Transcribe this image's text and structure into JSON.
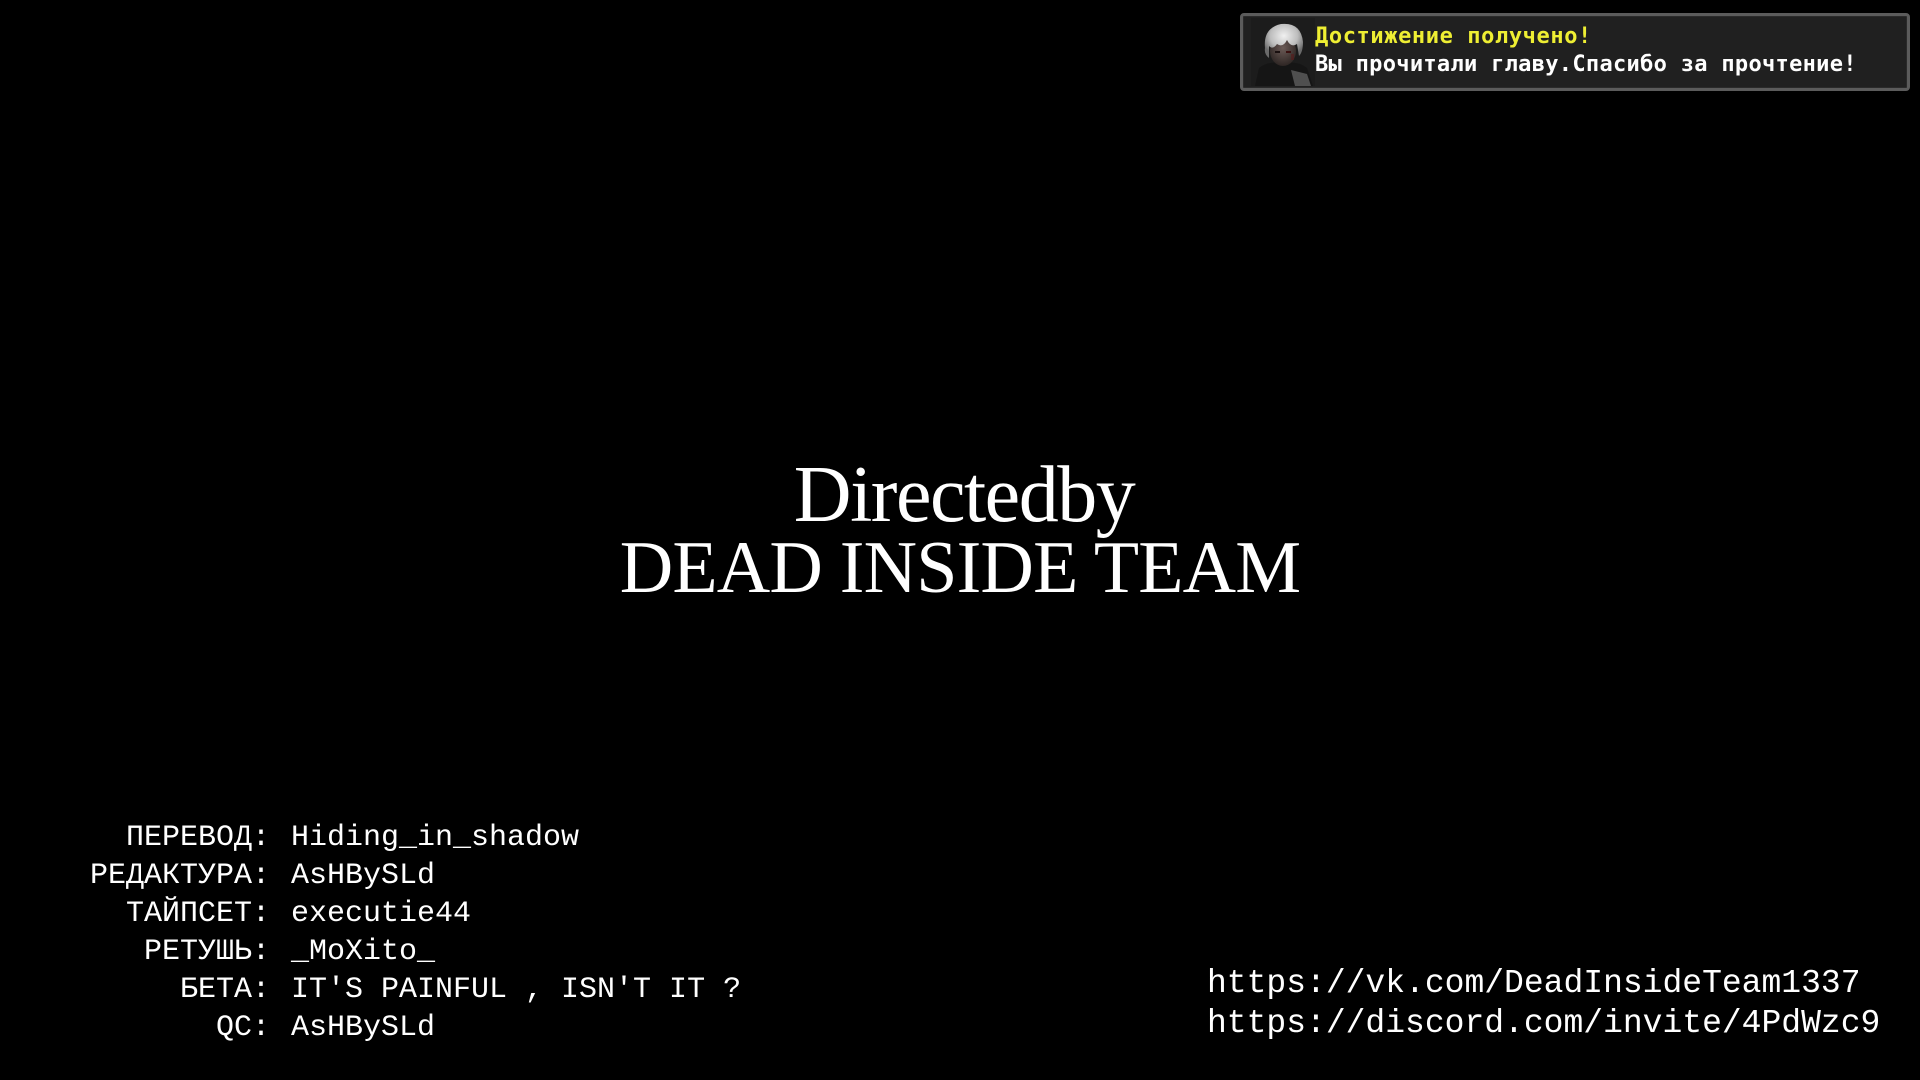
{
  "colors": {
    "background": "#000000",
    "text": "#ffffff",
    "toast_title": "#eeee33",
    "toast_background": "#202020",
    "toast_border": "#5b5b5b"
  },
  "toast": {
    "avatar_icon": "white-haired-character-portrait",
    "title": "Достижение получено!",
    "text": "Вы прочитали главу.Спасибо за прочтение!"
  },
  "title": {
    "line1": "Directedby",
    "line2": "DEAD INSIDE TEAM"
  },
  "credits": [
    {
      "role": "ПЕРЕВОД:",
      "name": "Hiding_in_shadow"
    },
    {
      "role": "РЕДАКТУРА:",
      "name": "AsHBySLd"
    },
    {
      "role": "ТАЙПСЕТ:",
      "name": "executie44"
    },
    {
      "role": "РЕТУШЬ:",
      "name": "_MoXito_"
    },
    {
      "role": "БЕТА:",
      "name": "IT'S PAINFUL , ISN'T IT ?"
    },
    {
      "role": "QC:",
      "name": "AsHBySLd"
    }
  ],
  "links": [
    "https://vk.com/DeadInsideTeam1337",
    "https://discord.com/invite/4PdWzc9"
  ]
}
